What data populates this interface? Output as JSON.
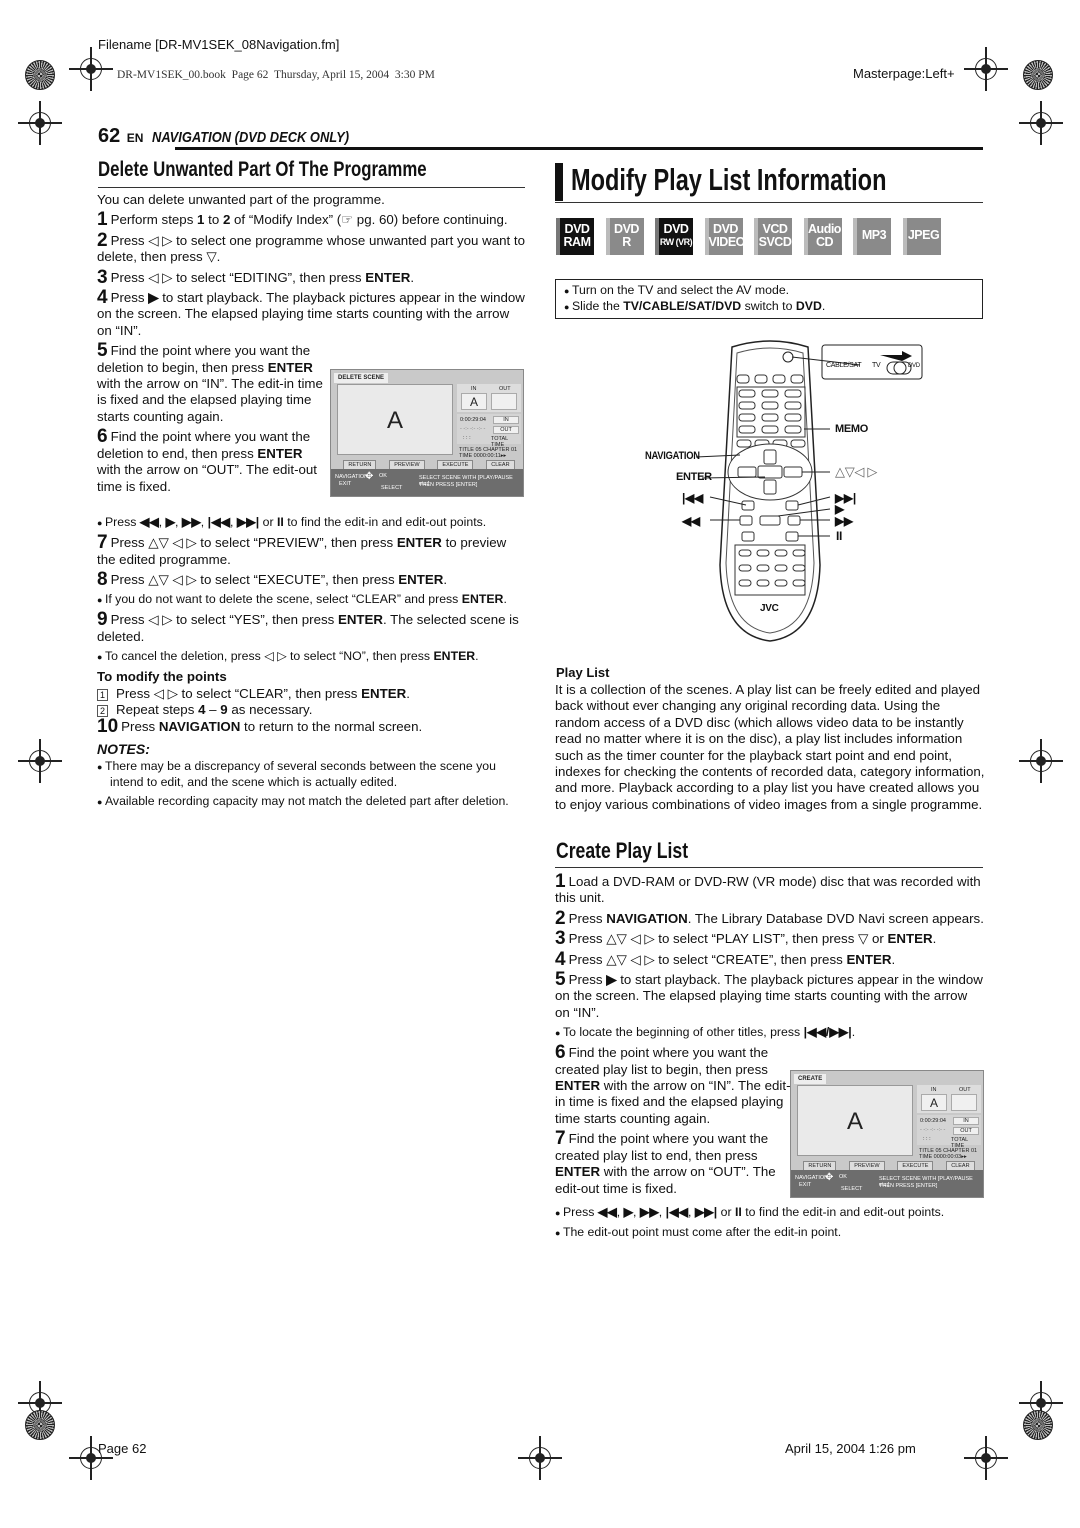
{
  "print_header": {
    "filename": "Filename [DR-MV1SEK_08Navigation.fm]",
    "book_line": "DR-MV1SEK_00.book  Page 62  Thursday, April 15, 2004  3:30 PM",
    "masterpage": "Masterpage:Left+"
  },
  "page_header": {
    "page_number": "62",
    "lang": "EN",
    "section": "NAVIGATION (DVD DECK ONLY)"
  },
  "left": {
    "heading": "Delete Unwanted Part Of The Programme",
    "intro": "You can delete unwanted part of the programme.",
    "groups": [
      [
        {
          "type": "step",
          "num": "1",
          "text": [
            "Perform steps ",
            {
              "b": "1"
            },
            " to ",
            {
              "b": "2"
            },
            " of “Modify Index” (☞ pg. 60) before continuing."
          ]
        },
        {
          "type": "step",
          "num": "2",
          "text": [
            "Press ◁ ▷ to select one programme whose unwanted part you want to delete, then press ▽."
          ]
        },
        {
          "type": "step",
          "num": "3",
          "text": [
            "Press ◁ ▷ to select “EDITING”, then press ",
            {
              "b": "ENTER"
            },
            "."
          ]
        },
        {
          "type": "step",
          "num": "4",
          "text": [
            "Press ",
            {
              "b": "▶"
            },
            " to start playback. The playback pictures appear in the window on the screen. The elapsed playing time starts counting with the arrow on “IN”."
          ]
        }
      ],
      [
        {
          "type": "step",
          "num": "5",
          "text": [
            "Find the point where you want the deletion to begin, then press ",
            {
              "b": "ENTER"
            },
            " with the arrow on “IN”. The edit-in time is fixed and the elapsed playing time starts counting again."
          ]
        },
        {
          "type": "step",
          "num": "6",
          "text": [
            "Find the point where you want the deletion to end, then press ",
            {
              "b": "ENTER"
            },
            " with the arrow on “OUT”. The edit-out time is fixed."
          ]
        }
      ],
      [
        {
          "type": "bullet",
          "text": [
            "Press ",
            {
              "b": "◀◀"
            },
            ", ",
            {
              "b": "▶"
            },
            ", ",
            {
              "b": "▶▶"
            },
            ", ",
            {
              "b": "|◀◀"
            },
            ", ",
            {
              "b": "▶▶|"
            },
            " or ",
            {
              "b": "II"
            },
            " to find the edit-in and edit-out points."
          ]
        },
        {
          "type": "step",
          "num": "7",
          "text": [
            "Press △▽ ◁ ▷ to select “PREVIEW”, then press ",
            {
              "b": "ENTER"
            },
            " to preview the edited programme."
          ]
        },
        {
          "type": "step",
          "num": "8",
          "text": [
            "Press △▽ ◁ ▷ to select “EXECUTE”, then press ",
            {
              "b": "ENTER"
            },
            "."
          ]
        },
        {
          "type": "bullet",
          "text": [
            "If you do not want to delete the scene, select “CLEAR” and press ",
            {
              "b": "ENTER"
            },
            "."
          ]
        },
        {
          "type": "step",
          "num": "9",
          "text": [
            "Press ◁ ▷ to select “YES”, then press ",
            {
              "b": "ENTER"
            },
            ". The selected scene is deleted."
          ]
        },
        {
          "type": "bullet",
          "text": [
            "To cancel the deletion, press ◁ ▷ to select “NO”, then press ",
            {
              "b": "ENTER"
            },
            "."
          ]
        },
        {
          "type": "subhead",
          "text": [
            "To modify the points"
          ]
        },
        {
          "type": "sub",
          "num": "1",
          "text": [
            "Press ◁ ▷ to select “CLEAR”, then press ",
            {
              "b": "ENTER"
            },
            "."
          ]
        },
        {
          "type": "sub",
          "num": "2",
          "text": [
            "Repeat steps ",
            {
              "b": "4"
            },
            " – ",
            {
              "b": "9"
            },
            " as necessary."
          ]
        },
        {
          "type": "step",
          "num": "10",
          "text": [
            "Press ",
            {
              "b": "NAVIGATION"
            },
            " to return to the normal screen."
          ]
        },
        {
          "type": "notes",
          "text": [
            "NOTES:"
          ]
        },
        {
          "type": "bullet",
          "text": [
            "There may be a discrepancy of several seconds between the scene you intend to edit, and the scene which is actually edited."
          ]
        },
        {
          "type": "bullet",
          "text": [
            "Available recording capacity may not match the deleted part after deletion."
          ]
        }
      ]
    ]
  },
  "screen_delete": {
    "title": "DELETE SCENE",
    "picture": "A",
    "in_label": "IN",
    "out_label": "OUT",
    "in_value": "A",
    "elapsed": "0:00:29:04",
    "dashes": "- -:- -:- -:- -",
    "colons": ":   :   :",
    "in_btn": "IN",
    "out_btn": "OUT",
    "total_time": "TOTAL TIME",
    "title_chapter": "TITLE 05 CHAPTER 01",
    "time": "TIME  0000:00:11▸▸",
    "buttons": [
      "RETURN",
      "PREVIEW",
      "EXECUTE",
      "CLEAR"
    ],
    "nav": "NAVIGATION",
    "exit": "EXIT",
    "ok": "OK",
    "select": "SELECT",
    "msg1": "SELECT SCENE WITH [PLAY/PAUSE etc.]",
    "msg2": "THEN PRESS [ENTER]"
  },
  "right": {
    "title": "Modify Play List Information",
    "badges": [
      {
        "l1": "DVD",
        "l2": "RAM",
        "active": true
      },
      {
        "l1": "DVD",
        "l2": "R",
        "active": false
      },
      {
        "l1": "DVD",
        "l2": "RW (VR)",
        "active": true
      },
      {
        "l1": "DVD",
        "l2": "VIDEO",
        "active": false
      },
      {
        "l1": "VCD",
        "l2": "SVCD",
        "active": false
      },
      {
        "l1": "Audio",
        "l2": "CD",
        "active": false
      },
      {
        "l1": "MP3",
        "l2": "",
        "active": false
      },
      {
        "l1": "JPEG",
        "l2": "",
        "active": false
      }
    ],
    "prep": [
      [
        "Turn on the TV and select the AV mode."
      ],
      [
        "Slide the ",
        {
          "b": "TV/CABLE/SAT/DVD"
        },
        " switch to ",
        {
          "b": "DVD"
        },
        "."
      ]
    ],
    "remote": {
      "switch_cable": "CABLE/SAT",
      "switch_tv": "TV",
      "switch_dvd": "DVD",
      "memo": "MEMO",
      "navigation": "NAVIGATION",
      "enter": "ENTER",
      "arrows": "△▽◁ ▷",
      "prev": "|◀◀",
      "rew": "◀◀",
      "next": "▶▶|",
      "play": "▶",
      "ff": "▶▶",
      "pause": "II",
      "brand": "JVC",
      "keys": [
        "1",
        "2",
        "3",
        "4",
        "5",
        "6",
        "7",
        "8",
        "9",
        "X",
        "0",
        ""
      ]
    },
    "playlist_heading": "Play List",
    "playlist_text": "It is a collection of the scenes. A play list can be freely edited and played back without ever changing any original recording data. Using the random access of a DVD disc (which allows video data to be instantly read no matter where it is on the disc), a play list includes information such as the timer counter for the playback start point and end point, indexes for checking the contents of recorded data, category information, and more. Playback according to a play list you have created allows you to enjoy various combinations of video images from a single programme.",
    "create_heading": "Create Play List",
    "groups": [
      [
        {
          "type": "step",
          "num": "1",
          "text": [
            "Load a DVD-RAM or DVD-RW (VR mode) disc that was recorded with this unit."
          ]
        },
        {
          "type": "step",
          "num": "2",
          "text": [
            "Press ",
            {
              "b": "NAVIGATION"
            },
            ". The Library Database DVD Navi screen appears."
          ]
        },
        {
          "type": "step",
          "num": "3",
          "text": [
            "Press △▽ ◁ ▷ to select “PLAY LIST”, then press ▽ or ",
            {
              "b": "ENTER"
            },
            "."
          ]
        },
        {
          "type": "step",
          "num": "4",
          "text": [
            "Press △▽ ◁ ▷ to select “CREATE”, then press ",
            {
              "b": "ENTER"
            },
            "."
          ]
        },
        {
          "type": "step",
          "num": "5",
          "text": [
            "Press ",
            {
              "b": "▶"
            },
            " to start playback. The playback pictures appear in the window on the screen. The elapsed playing time starts counting with the arrow on “IN”."
          ]
        },
        {
          "type": "bullet",
          "text": [
            "To locate the beginning of other titles, press ",
            {
              "b": "|◀◀/▶▶|"
            },
            "."
          ]
        }
      ],
      [
        {
          "type": "step",
          "num": "6",
          "text": [
            "Find the point where you want the created play list to begin, then press ",
            {
              "b": "ENTER"
            },
            " with the arrow on “IN”. The edit-in time is fixed and the elapsed playing time starts counting again."
          ]
        },
        {
          "type": "step",
          "num": "7",
          "text": [
            "Find the point where you want the created play list to end, then press ",
            {
              "b": "ENTER"
            },
            " with the arrow on “OUT”. The edit-out time is fixed."
          ]
        }
      ],
      [
        {
          "type": "bullet",
          "text": [
            "Press ",
            {
              "b": "◀◀"
            },
            ", ",
            {
              "b": "▶"
            },
            ", ",
            {
              "b": "▶▶"
            },
            ", ",
            {
              "b": "|◀◀"
            },
            ", ",
            {
              "b": "▶▶|"
            },
            " or ",
            {
              "b": "II"
            },
            " to find the edit-in and edit-out points."
          ]
        },
        {
          "type": "bullet",
          "text": [
            "The edit-out point must come after the edit-in point."
          ]
        }
      ]
    ]
  },
  "screen_create": {
    "title": "CREATE",
    "picture": "A",
    "in_label": "IN",
    "out_label": "OUT",
    "in_value": "A",
    "elapsed": "0:00:29:04",
    "dashes": "- -:- -:- -:- -",
    "colons": ":   :   :",
    "in_btn": "IN",
    "out_btn": "OUT",
    "total_time": "TOTAL TIME",
    "title_chapter": "TITLE 05 CHAPTER 01",
    "time": "TIME  0000:00:03▸▸",
    "buttons": [
      "RETURN",
      "PREVIEW",
      "EXECUTE",
      "CLEAR"
    ],
    "nav": "NAVIGATION",
    "exit": "EXIT",
    "ok": "OK",
    "select": "SELECT",
    "msg1": "SELECT SCENE WITH [PLAY/PAUSE etc.]",
    "msg2": "THEN PRESS [ENTER]"
  },
  "footer": {
    "page": "Page 62",
    "date": "April 15, 2004 1:26 pm"
  }
}
